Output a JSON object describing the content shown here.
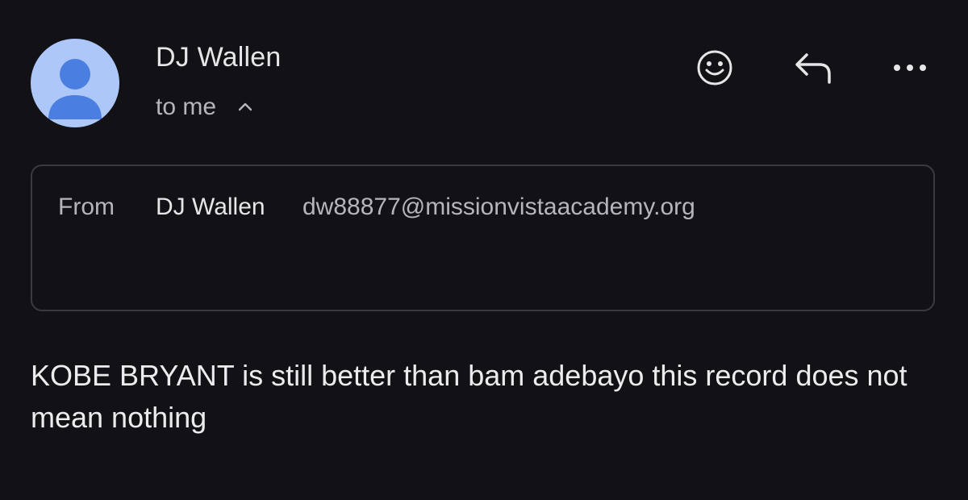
{
  "sender": {
    "name": "DJ Wallen",
    "avatar_icon": "person-avatar-icon",
    "avatar_bg": "#adc8f8",
    "avatar_fg": "#4a7ee0"
  },
  "recipient": {
    "label": "to me",
    "toggle_icon": "chevron-up-icon"
  },
  "actions": [
    {
      "name": "emoji-reaction-icon"
    },
    {
      "name": "reply-icon"
    },
    {
      "name": "more-options-icon"
    }
  ],
  "details": {
    "from_label": "From",
    "from_name": "DJ Wallen",
    "from_email": "dw88877@missionvistaacademy.org"
  },
  "message": {
    "body": "KOBE BRYANT is still better than bam adebayo this record does not mean nothing"
  },
  "theme": {
    "background": "#121116",
    "text_primary": "#e6e6e9",
    "text_secondary": "#b6b5bd",
    "border": "#3b3a40"
  }
}
